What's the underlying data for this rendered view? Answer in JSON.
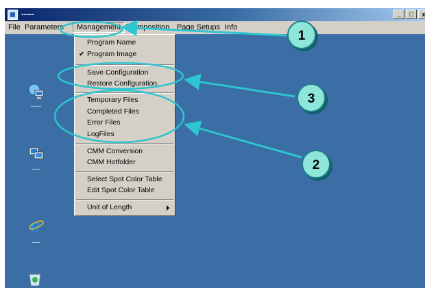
{
  "window": {
    "title": "-----",
    "buttons": {
      "minimize": "_",
      "maximize": "□",
      "close": "x"
    }
  },
  "menubar": {
    "file": "File",
    "parameters": "Parameters",
    "management": "Management",
    "deimposition": "DeImposition",
    "page_setups": "Page Setups",
    "info": "Info"
  },
  "management_menu": {
    "program_name": "Program Name",
    "program_image": "Program Image",
    "program_image_checked": true,
    "check_mark": "✔",
    "save_configuration": "Save Configuration",
    "restore_configuration": "Restore Configuration",
    "temporary_files": "Temporary Files",
    "completed_files": "Completed Files",
    "error_files": "Error Files",
    "logfiles": "LogFiles",
    "cmm_conversion": "CMM Conversion",
    "cmm_hotfolder": "CMM Hotfolder",
    "select_spot_color_table": "Select Spot Color Table",
    "edit_spot_color_table": "Edit Spot Color Table",
    "unit_of_length": "Unit of Length"
  },
  "desktop": {
    "icons": [
      {
        "icon": "network-computer-icon",
        "label": "-----"
      },
      {
        "icon": "network-places-icon",
        "label": "----"
      },
      {
        "icon": "internet-explorer-icon",
        "label": "----"
      },
      {
        "icon": "recycle-bin-icon",
        "label": ""
      }
    ]
  },
  "callouts": {
    "one": "1",
    "two": "2",
    "three": "3"
  },
  "colors": {
    "desktop": "#3a6ea5",
    "menu": "#d4d0c8",
    "callout_fill": "#8ee6da",
    "callout_stroke": "#2ec4d0"
  }
}
